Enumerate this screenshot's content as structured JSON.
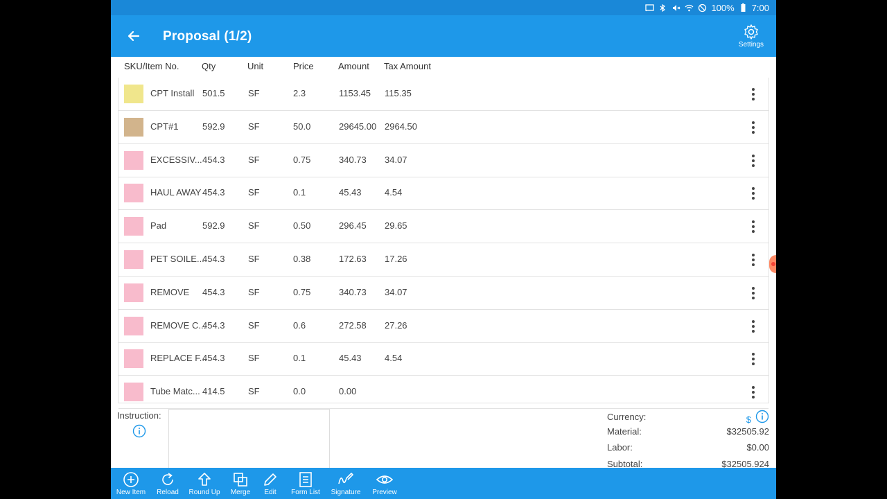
{
  "status": {
    "battery": "100%",
    "time": "7:00"
  },
  "appbar": {
    "title": "Proposal (1/2)",
    "settings_label": "Settings"
  },
  "columns": [
    "SKU/Item No.",
    "Qty",
    "Unit",
    "Price",
    "Amount",
    "Tax Amount"
  ],
  "rows": [
    {
      "color": "#f0e68c",
      "sku": "CPT Install",
      "qty": "501.5",
      "unit": "SF",
      "price": "2.3",
      "amount": "1153.45",
      "tax": "115.35"
    },
    {
      "color": "#d2b48c",
      "sku": "CPT#1",
      "qty": "592.9",
      "unit": "SF",
      "price": "50.0",
      "amount": "29645.00",
      "tax": "2964.50"
    },
    {
      "color": "#f8bbcc",
      "sku": "EXCESSIV...",
      "qty": "454.3",
      "unit": "SF",
      "price": "0.75",
      "amount": "340.73",
      "tax": "34.07"
    },
    {
      "color": "#f8bbcc",
      "sku": "HAUL AWAY",
      "qty": "454.3",
      "unit": "SF",
      "price": "0.1",
      "amount": "45.43",
      "tax": "4.54"
    },
    {
      "color": "#f8bbcc",
      "sku": "Pad",
      "qty": "592.9",
      "unit": "SF",
      "price": "0.50",
      "amount": "296.45",
      "tax": "29.65"
    },
    {
      "color": "#f8bbcc",
      "sku": "PET SOILE...",
      "qty": "454.3",
      "unit": "SF",
      "price": "0.38",
      "amount": "172.63",
      "tax": "17.26"
    },
    {
      "color": "#f8bbcc",
      "sku": "REMOVE",
      "qty": "454.3",
      "unit": "SF",
      "price": "0.75",
      "amount": "340.73",
      "tax": "34.07"
    },
    {
      "color": "#f8bbcc",
      "sku": "REMOVE C...",
      "qty": "454.3",
      "unit": "SF",
      "price": "0.6",
      "amount": "272.58",
      "tax": "27.26"
    },
    {
      "color": "#f8bbcc",
      "sku": "REPLACE F...",
      "qty": "454.3",
      "unit": "SF",
      "price": "0.1",
      "amount": "45.43",
      "tax": "4.54"
    },
    {
      "color": "#f8bbcc",
      "sku": "Tube Matc...",
      "qty": "414.5",
      "unit": "SF",
      "price": "0.0",
      "amount": "0.00",
      "tax": ""
    }
  ],
  "instruction": {
    "label": "Instruction:",
    "value": ""
  },
  "totals": {
    "currency_label": "Currency:",
    "currency_symbol": "$",
    "material_label": "Material:",
    "material_value": "$32505.92",
    "labor_label": "Labor:",
    "labor_value": "$0.00",
    "subtotal_label": "Subtotal:",
    "subtotal_value": "$32505.924"
  },
  "toolbar": [
    {
      "label": "New Item",
      "icon": "plus-circle-icon"
    },
    {
      "label": "Reload",
      "icon": "reload-icon"
    },
    {
      "label": "Round Up",
      "icon": "arrow-up-icon"
    },
    {
      "label": "Merge",
      "icon": "merge-icon"
    },
    {
      "label": "Edit",
      "icon": "pencil-icon"
    },
    {
      "label": "Form List",
      "icon": "form-list-icon"
    },
    {
      "label": "Signature",
      "icon": "signature-icon"
    },
    {
      "label": "Preview",
      "icon": "eye-icon"
    }
  ],
  "colors": {
    "primary": "#1e98e9",
    "status_bar": "#1a88d8",
    "accent": "#f44336"
  }
}
